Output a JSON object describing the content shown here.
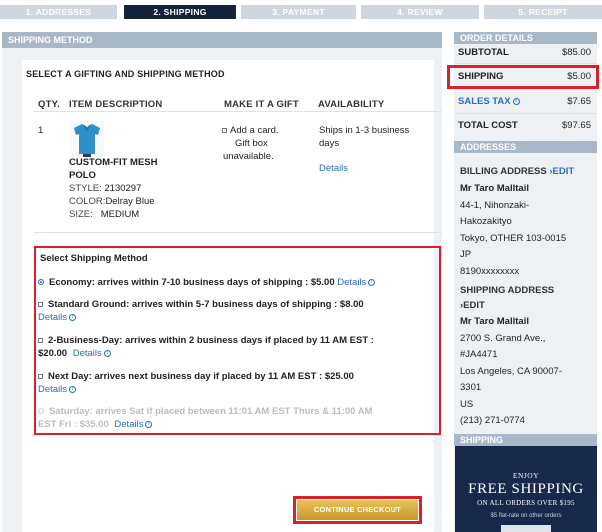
{
  "steps": [
    {
      "label": "1. ADDRESSES"
    },
    {
      "label": "2. SHIPPING"
    },
    {
      "label": "3. PAYMENT"
    },
    {
      "label": "4. REVIEW"
    },
    {
      "label": "5. RECEIPT"
    }
  ],
  "main": {
    "header": "SHIPPING METHOD",
    "section_title": "SELECT A GIFTING AND SHIPPING METHOD",
    "columns": {
      "qty": "QTY.",
      "description": "ITEM DESCRIPTION",
      "gift": "MAKE IT A GIFT",
      "availability": "AVAILABILITY"
    },
    "item": {
      "qty": "1",
      "name_line1": "CUSTOM-FIT MESH",
      "name_line2": "POLO",
      "style_label": "STYLE:",
      "style_value": "2130297",
      "color_label": "COLOR:",
      "color_value": "Delray Blue",
      "size_label": "SIZE:",
      "size_value": "MEDIUM",
      "gift_line1": "Add a card.",
      "gift_line2": "Gift box",
      "gift_line3": "unavailable.",
      "availability_line1": "Ships in 1-3 business",
      "availability_line2": "days",
      "details": "Details"
    },
    "shipping": {
      "title": "Select Shipping Method",
      "options": [
        {
          "text": "Economy: arrives within 7-10 business days of shipping : $5.00",
          "details": "Details"
        },
        {
          "text": "Standard Ground: arrives within 5-7 business days of shipping : $8.00",
          "details": "Details"
        },
        {
          "text_line1": "2-Business-Day: arrives within 2 business days if placed by 11 AM EST :",
          "text_line2": "$20.00",
          "details": "Details"
        },
        {
          "text": "Next Day: arrives next business day if placed by 11 AM EST : $25.00",
          "details": "Details"
        },
        {
          "text_line1": "Saturday: arrives Sat if placed between 11:01 AM EST Thurs & 11:00 AM",
          "text_line2": "EST Fri : $35.00",
          "details": "Details"
        }
      ]
    },
    "continue_label": "CONTINUE CHECKOUT"
  },
  "sidebar": {
    "order_header": "ORDER DETAILS",
    "subtotal_label": "SUBTOTAL",
    "subtotal_value": "$85.00",
    "shipping_label": "SHIPPING",
    "shipping_value": "$5.00",
    "tax_label": "SALES TAX",
    "tax_value": "$7.65",
    "total_label": "TOTAL COST",
    "total_value": "$97.65",
    "addresses_header": "ADDRESSES",
    "billing_label": "BILLING ADDRESS",
    "edit_label": "EDIT",
    "billing": [
      "Mr Taro Malltail",
      "44-1, Nihonzaki-",
      "Hakozakityo",
      "Tokyo, OTHER 103-0015",
      "JP",
      "8190xxxxxxxx"
    ],
    "shipping_addr_label": "SHIPPING ADDRESS",
    "shipping_addr": [
      "Mr Taro Malltail",
      "2700 S. Grand Ave.,",
      "#JA4471",
      "Los Angeles, CA 90007-",
      "3301",
      "US",
      "(213) 271-0774"
    ],
    "shipping_header": "SHIPPING",
    "promo": {
      "line1": "ENJOY",
      "line2": "FREE SHIPPING",
      "line3": "ON ALL ORDERS OVER $195",
      "line4": "$5 flat-rate on other orders"
    }
  },
  "colors": {
    "accent": "#dd1f2b",
    "active_step": "#16223b",
    "header": "#a9b8c6",
    "link": "#2a6ebd",
    "promo_bg": "#17284a"
  }
}
